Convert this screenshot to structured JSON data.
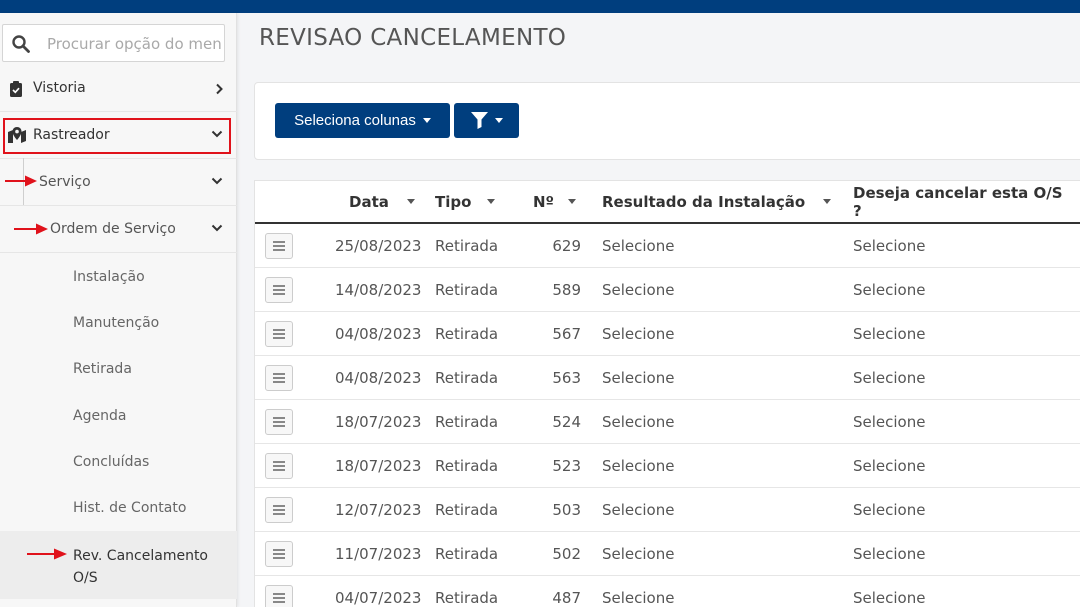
{
  "search": {
    "placeholder": "Procurar opção do menu"
  },
  "menu": {
    "vistoria": "Vistoria",
    "rastreador": "Rastreador",
    "servico": "Serviço",
    "ordem_servico": "Ordem de Serviço",
    "sub_items": [
      "Instalação",
      "Manutenção",
      "Retirada",
      "Agenda",
      "Concluídas",
      "Hist. de Contato"
    ],
    "rev_cancelamento_line1": "Rev. Cancelamento",
    "rev_cancelamento_line2": "O/S"
  },
  "page": {
    "title": "REVISAO CANCELAMENTO"
  },
  "toolbar": {
    "select_columns_label": "Seleciona colunas"
  },
  "table": {
    "headers": [
      "Data",
      "Tipo",
      "Nº",
      "Resultado da Instalação",
      "Deseja cancelar esta O/S ?"
    ],
    "rows": [
      [
        "25/08/2023",
        "Retirada",
        "629",
        "Selecione",
        "Selecione"
      ],
      [
        "14/08/2023",
        "Retirada",
        "589",
        "Selecione",
        "Selecione"
      ],
      [
        "04/08/2023",
        "Retirada",
        "567",
        "Selecione",
        "Selecione"
      ],
      [
        "04/08/2023",
        "Retirada",
        "563",
        "Selecione",
        "Selecione"
      ],
      [
        "18/07/2023",
        "Retirada",
        "524",
        "Selecione",
        "Selecione"
      ],
      [
        "18/07/2023",
        "Retirada",
        "523",
        "Selecione",
        "Selecione"
      ],
      [
        "12/07/2023",
        "Retirada",
        "503",
        "Selecione",
        "Selecione"
      ],
      [
        "11/07/2023",
        "Retirada",
        "502",
        "Selecione",
        "Selecione"
      ],
      [
        "04/07/2023",
        "Retirada",
        "487",
        "Selecione",
        "Selecione"
      ]
    ]
  },
  "colors": {
    "brand": "#003e7e",
    "highlight": "#e0121b"
  }
}
